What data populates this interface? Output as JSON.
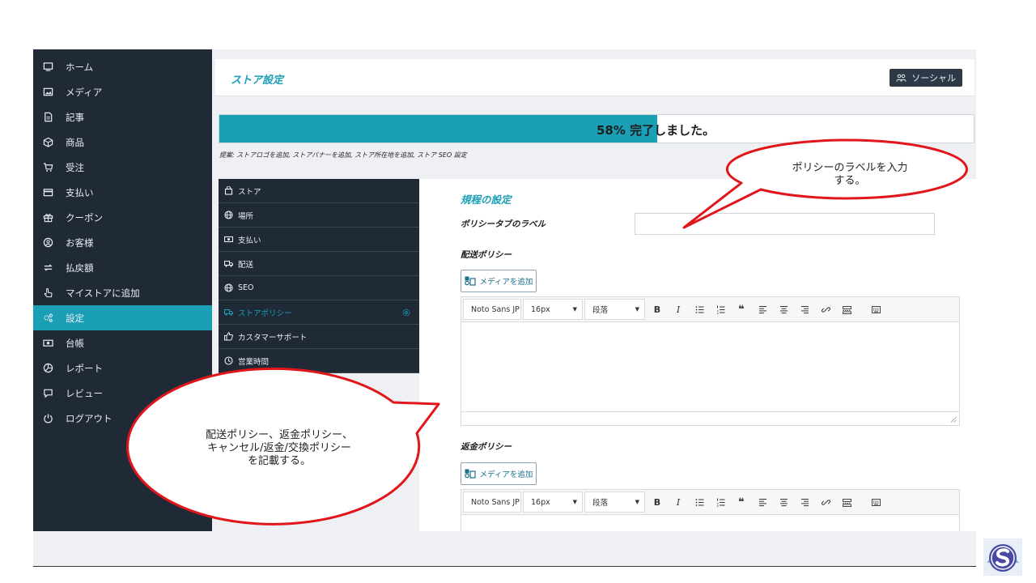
{
  "sidebar": {
    "items": [
      {
        "label": "ホーム",
        "icon": "monitor-icon"
      },
      {
        "label": "メディア",
        "icon": "image-icon"
      },
      {
        "label": "記事",
        "icon": "document-icon"
      },
      {
        "label": "商品",
        "icon": "cube-icon"
      },
      {
        "label": "受注",
        "icon": "cart-icon"
      },
      {
        "label": "支払い",
        "icon": "credit-card-icon"
      },
      {
        "label": "クーポン",
        "icon": "gift-icon"
      },
      {
        "label": "お客様",
        "icon": "user-circle-icon"
      },
      {
        "label": "払戻額",
        "icon": "refund-icon"
      },
      {
        "label": "マイストアに追加",
        "icon": "hand-pointer-icon"
      },
      {
        "label": "設定",
        "icon": "gears-icon",
        "active": true
      },
      {
        "label": "台帳",
        "icon": "money-icon"
      },
      {
        "label": "レポート",
        "icon": "chart-pie-icon"
      },
      {
        "label": "レビュー",
        "icon": "comment-icon"
      },
      {
        "label": "ログアウト",
        "icon": "power-icon"
      }
    ]
  },
  "header": {
    "title": "ストア設定",
    "social_button": "ソーシャル"
  },
  "progress": {
    "percent_label": "58%",
    "suffix": "完了しました。",
    "value": 0.58
  },
  "suggestion": "提案: ストアロゴを追加, ストアバナーを追加, ストア所在地を追加, ストア SEO 設定",
  "tabs": [
    {
      "label": "ストア",
      "icon": "store-bag-icon"
    },
    {
      "label": "場所",
      "icon": "globe-icon"
    },
    {
      "label": "支払い",
      "icon": "money-icon"
    },
    {
      "label": "配送",
      "icon": "truck-icon"
    },
    {
      "label": "SEO",
      "icon": "globe-icon"
    },
    {
      "label": "ストアポリシー",
      "icon": "truck-policy-icon",
      "active": true
    },
    {
      "label": "カスタマーサポート",
      "icon": "thumbs-up-icon"
    },
    {
      "label": "営業時間",
      "icon": "clock-icon"
    }
  ],
  "policy": {
    "section_title": "規程の設定",
    "tab_label_field": "ポリシータブのラベル",
    "tab_label_value": "",
    "shipping_label": "配送ポリシー",
    "refund_label": "返金ポリシー",
    "add_media": "メディアを追加",
    "editor": {
      "font": "Noto Sans JP",
      "size": "16px",
      "format": "段落"
    }
  },
  "callouts": {
    "top": [
      "ポリシーのラベルを入力",
      "する。"
    ],
    "left": [
      "配送ポリシー、返金ポリシー、",
      "キャンセル/返金/交換ポリシー",
      "を記載する。"
    ]
  },
  "colors": {
    "sidebar_bg": "#1f2a36",
    "accent": "#1a9fb5",
    "callout_border": "#e0161b"
  }
}
